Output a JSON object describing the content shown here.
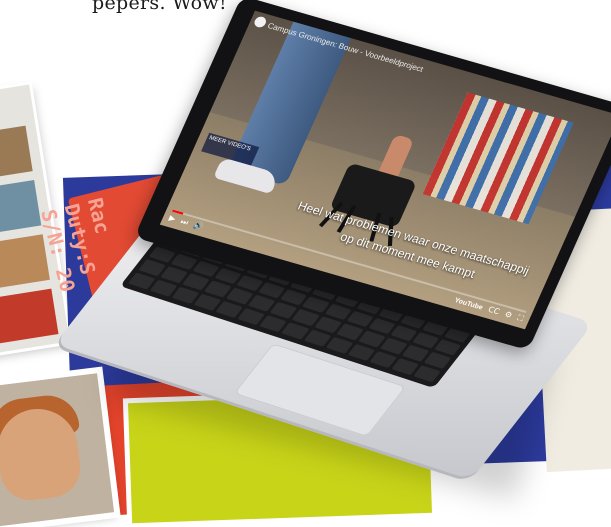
{
  "caption": {
    "text": "pepers. Wow!"
  },
  "background": {
    "tag_text": "Rac Duty:S S/N: 20"
  },
  "video": {
    "title": "Campus Groningen: Bouw - Voorbeeldproject",
    "subtitle_line1": "Heel wat problemen waar onze maatschappij",
    "subtitle_line2": "op dit moment mee kampt",
    "info_box": "MEER VIDEO'S",
    "progress": 0.03,
    "controls": {
      "play_icon": "play-icon",
      "next_icon": "next-icon",
      "volume_icon": "volume-icon",
      "cc_label": "CC",
      "settings_icon": "gear-icon",
      "youtube_label": "YouTube",
      "fullscreen_icon": "fullscreen-icon"
    }
  },
  "colors": {
    "accent_blue": "#2c3a9c",
    "accent_red": "#e24a33",
    "accent_yellow": "#c8d418",
    "progress_red": "#ff0000"
  }
}
